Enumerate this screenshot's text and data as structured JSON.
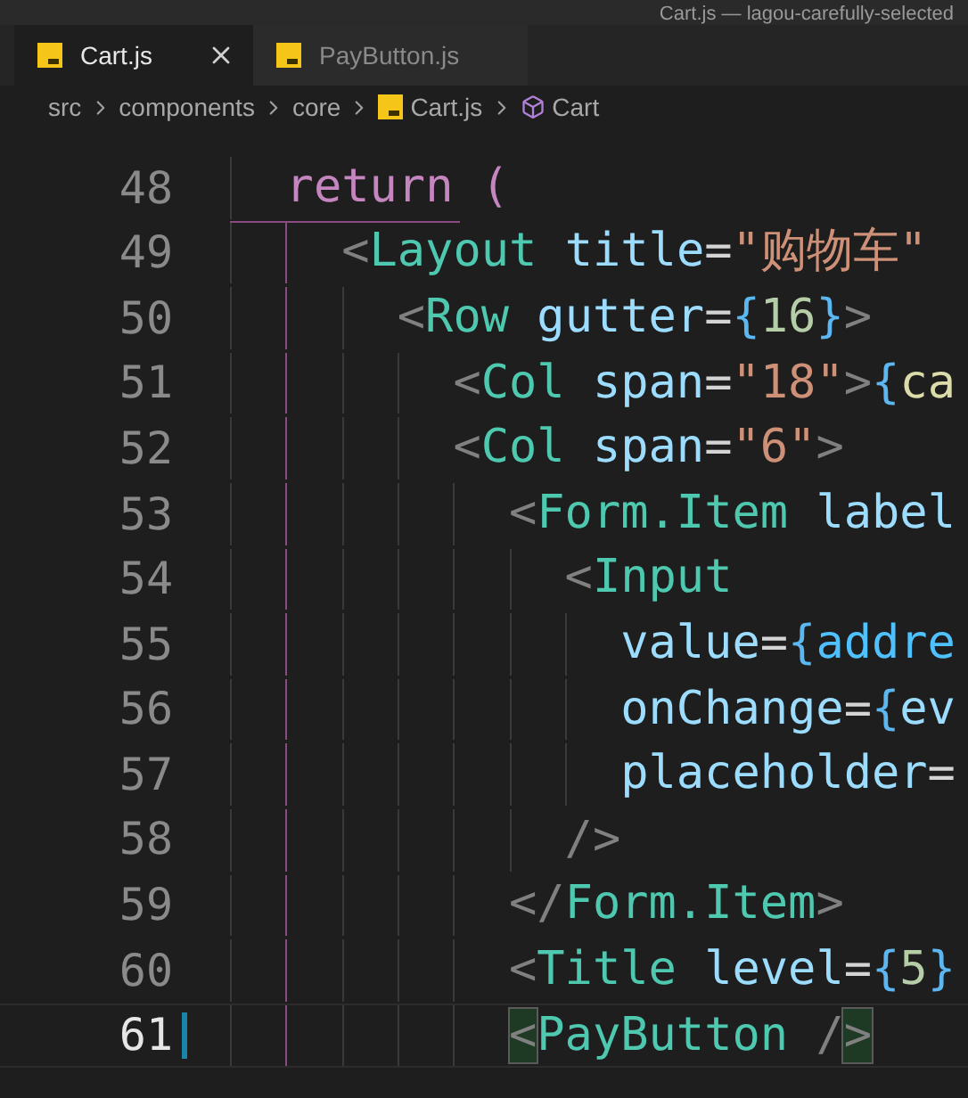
{
  "window": {
    "title": "Cart.js — lagou-carefully-selected"
  },
  "tabs": [
    {
      "label": "Cart.js",
      "selected": true
    },
    {
      "label": "PayButton.js",
      "selected": false
    }
  ],
  "breadcrumb": [
    {
      "label": "src",
      "kind": "folder"
    },
    {
      "label": "components",
      "kind": "folder"
    },
    {
      "label": "core",
      "kind": "folder"
    },
    {
      "label": "Cart.js",
      "kind": "file"
    },
    {
      "label": "Cart",
      "kind": "symbol"
    }
  ],
  "editor": {
    "lines": [
      {
        "number": "48",
        "current": false,
        "tokens": [
          {
            "kind": "keyword",
            "text": "return ("
          }
        ],
        "children": [
          {
            "number": "49",
            "current": false,
            "tokens": [
              {
                "kind": "punct",
                "text": "<"
              },
              {
                "kind": "tag",
                "text": "Layout"
              },
              {
                "kind": "attr",
                "text": " title"
              },
              {
                "kind": "op",
                "text": "="
              },
              {
                "kind": "string",
                "text": "\"购物车\""
              }
            ],
            "children": [
              {
                "number": "50",
                "current": false,
                "tokens": [
                  {
                    "kind": "punct",
                    "text": "<"
                  },
                  {
                    "kind": "tag",
                    "text": "Row"
                  },
                  {
                    "kind": "attr",
                    "text": " gutter"
                  },
                  {
                    "kind": "op",
                    "text": "="
                  },
                  {
                    "kind": "brace",
                    "text": "{"
                  },
                  {
                    "kind": "number",
                    "text": "16"
                  },
                  {
                    "kind": "brace",
                    "text": "}"
                  },
                  {
                    "kind": "punct",
                    "text": ">"
                  }
                ],
                "children": [
                  {
                    "number": "51",
                    "current": false,
                    "tokens": [
                      {
                        "kind": "punct",
                        "text": "<"
                      },
                      {
                        "kind": "tag",
                        "text": "Col"
                      },
                      {
                        "kind": "attr",
                        "text": " span"
                      },
                      {
                        "kind": "op",
                        "text": "="
                      },
                      {
                        "kind": "string",
                        "text": "\"18\""
                      },
                      {
                        "kind": "punct",
                        "text": ">"
                      },
                      {
                        "kind": "brace",
                        "text": "{"
                      },
                      {
                        "kind": "func",
                        "text": "ca"
                      }
                    ]
                  },
                  {
                    "number": "52",
                    "current": false,
                    "tokens": [
                      {
                        "kind": "punct",
                        "text": "<"
                      },
                      {
                        "kind": "tag",
                        "text": "Col"
                      },
                      {
                        "kind": "attr",
                        "text": " span"
                      },
                      {
                        "kind": "op",
                        "text": "="
                      },
                      {
                        "kind": "string",
                        "text": "\"6\""
                      },
                      {
                        "kind": "punct",
                        "text": ">"
                      }
                    ],
                    "children": [
                      {
                        "number": "53",
                        "current": false,
                        "tokens": [
                          {
                            "kind": "punct",
                            "text": "<"
                          },
                          {
                            "kind": "tag",
                            "text": "Form.Item"
                          },
                          {
                            "kind": "attr",
                            "text": " label"
                          }
                        ],
                        "children": [
                          {
                            "number": "54",
                            "current": false,
                            "tokens": [
                              {
                                "kind": "punct",
                                "text": "<"
                              },
                              {
                                "kind": "tag",
                                "text": "Input"
                              }
                            ],
                            "children": [
                              {
                                "number": "55",
                                "current": false,
                                "tokens": [
                                  {
                                    "kind": "attr",
                                    "text": "value"
                                  },
                                  {
                                    "kind": "op",
                                    "text": "="
                                  },
                                  {
                                    "kind": "brace",
                                    "text": "{"
                                  },
                                  {
                                    "kind": "variable",
                                    "text": "addre"
                                  }
                                ]
                              },
                              {
                                "number": "56",
                                "current": false,
                                "tokens": [
                                  {
                                    "kind": "attr",
                                    "text": "onChange"
                                  },
                                  {
                                    "kind": "op",
                                    "text": "="
                                  },
                                  {
                                    "kind": "brace",
                                    "text": "{"
                                  },
                                  {
                                    "kind": "attr",
                                    "text": "ev"
                                  }
                                ]
                              },
                              {
                                "number": "57",
                                "current": false,
                                "tokens": [
                                  {
                                    "kind": "attr",
                                    "text": "placeholder"
                                  },
                                  {
                                    "kind": "op",
                                    "text": "="
                                  }
                                ]
                              }
                            ]
                          },
                          {
                            "number": "58",
                            "current": false,
                            "tokens": [
                              {
                                "kind": "punct",
                                "text": "/>"
                              }
                            ]
                          }
                        ]
                      },
                      {
                        "number": "59",
                        "current": false,
                        "tokens": [
                          {
                            "kind": "punct",
                            "text": "</"
                          },
                          {
                            "kind": "tag",
                            "text": "Form.Item"
                          },
                          {
                            "kind": "punct",
                            "text": ">"
                          }
                        ]
                      },
                      {
                        "number": "60",
                        "current": false,
                        "tokens": [
                          {
                            "kind": "punct",
                            "text": "<"
                          },
                          {
                            "kind": "tag",
                            "text": "Title"
                          },
                          {
                            "kind": "attr",
                            "text": " level"
                          },
                          {
                            "kind": "op",
                            "text": "="
                          },
                          {
                            "kind": "brace",
                            "text": "{"
                          },
                          {
                            "kind": "number",
                            "text": "5"
                          },
                          {
                            "kind": "brace",
                            "text": "}"
                          }
                        ]
                      },
                      {
                        "number": "61",
                        "current": true,
                        "tokens": [
                          {
                            "kind": "match",
                            "text": "<"
                          },
                          {
                            "kind": "tag",
                            "text": "PayButton"
                          },
                          {
                            "kind": "punct",
                            "text": " /"
                          },
                          {
                            "kind": "match",
                            "text": ">"
                          }
                        ]
                      }
                    ]
                  }
                ]
              }
            ]
          }
        ]
      }
    ]
  }
}
